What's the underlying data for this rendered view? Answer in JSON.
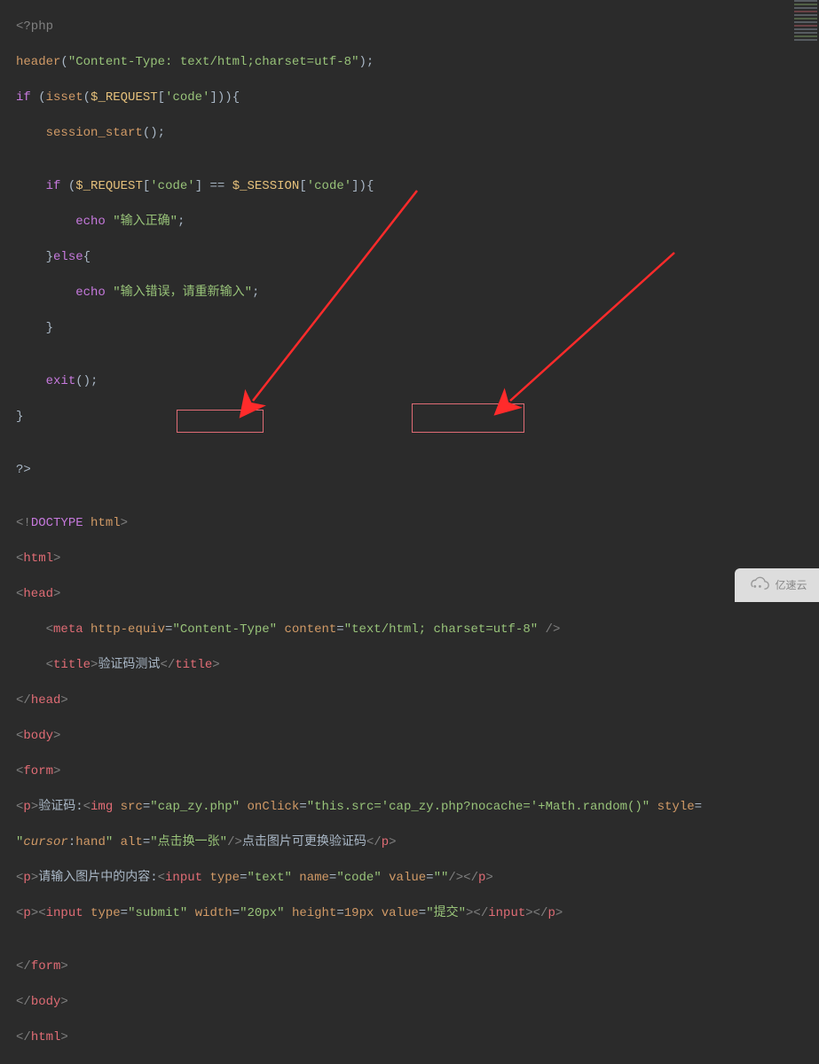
{
  "code": {
    "l1": "<?php",
    "l2a": "header",
    "l2b": "(",
    "l2c": "\"Content-Type: text/html;charset=utf-8\"",
    "l2d": ");",
    "l3a": "if",
    "l3b": " (",
    "l3c": "isset",
    "l3d": "(",
    "l3e": "$_REQUEST",
    "l3f": "[",
    "l3g": "'code'",
    "l3h": "])){",
    "l4a": "    ",
    "l4b": "session_start",
    "l4c": "();",
    "l5": "",
    "l6a": "    ",
    "l6b": "if",
    "l6c": " (",
    "l6d": "$_REQUEST",
    "l6e": "[",
    "l6f": "'code'",
    "l6g": "] == ",
    "l6h": "$_SESSION",
    "l6i": "[",
    "l6j": "'code'",
    "l6k": "]){",
    "l7a": "        ",
    "l7b": "echo",
    "l7c": " ",
    "l7d": "\"输入正确\"",
    "l7e": ";",
    "l8a": "    }",
    "l8b": "else",
    "l8c": "{",
    "l9a": "        ",
    "l9b": "echo",
    "l9c": " ",
    "l9d": "\"输入错误，请重新输入\"",
    "l9e": ";",
    "l10": "    }",
    "l11": "",
    "l12a": "    ",
    "l12b": "exit",
    "l12c": "();",
    "l13": "}",
    "l14": "",
    "l15": "?>",
    "l16": "",
    "l17a": "<!",
    "l17b": "DOCTYPE",
    "l17c": " ",
    "l17d": "html",
    "l17e": ">",
    "l18a": "<",
    "l18b": "html",
    "l18c": ">",
    "l19a": "<",
    "l19b": "head",
    "l19c": ">",
    "l20a": "    <",
    "l20b": "meta",
    "l20c": " ",
    "l20d": "http-equiv",
    "l20e": "=",
    "l20f": "\"Content-Type\"",
    "l20g": " ",
    "l20h": "content",
    "l20i": "=",
    "l20j": "\"text/html; charset=utf-8\"",
    "l20k": " />",
    "l21a": "    <",
    "l21b": "title",
    "l21c": ">",
    "l21d": "验证码测试",
    "l21e": "</",
    "l21f": "title",
    "l21g": ">",
    "l22a": "</",
    "l22b": "head",
    "l22c": ">",
    "l23a": "<",
    "l23b": "body",
    "l23c": ">",
    "l24a": "<",
    "l24b": "form",
    "l24c": ">",
    "l25a": "<",
    "l25b": "p",
    "l25c": ">",
    "l25d": "验证码:",
    "l25e": "<",
    "l25f": "img",
    "l25g": " ",
    "l25h": "src",
    "l25i": "=",
    "l25j": "\"",
    "l25k": "cap_zy.php",
    "l25l": "\"",
    "l25m": " ",
    "l25n": "onClick",
    "l25o": "=",
    "l25p": "\"this.src='",
    "l25q": "cap_zy.php",
    "l25r": "?nocache='+Math.random()\"",
    "l25s": " ",
    "l25t": "style",
    "l25u": "=",
    "l26a": "\"",
    "l26b": "cursor",
    "l26c": ":",
    "l26d": "hand",
    "l26e": "\"",
    "l26f": " ",
    "l26g": "alt",
    "l26h": "=",
    "l26i": "\"点击换一张\"",
    "l26j": "/>",
    "l26k": "点击图片可更换验证码",
    "l26l": "</",
    "l26m": "p",
    "l26n": ">",
    "l27a": "<",
    "l27b": "p",
    "l27c": ">",
    "l27d": "请输入图片中的内容:",
    "l27e": "<",
    "l27f": "input",
    "l27g": " ",
    "l27h": "type",
    "l27i": "=",
    "l27j": "\"text\"",
    "l27k": " ",
    "l27l": "name",
    "l27m": "=",
    "l27n": "\"code\"",
    "l27o": " ",
    "l27p": "value",
    "l27q": "=",
    "l27r": "\"\"",
    "l27s": "/></",
    "l27t": "p",
    "l27u": ">",
    "l28a": "<",
    "l28b": "p",
    "l28c": ">",
    "l28d": "<",
    "l28e": "input",
    "l28f": " ",
    "l28g": "type",
    "l28h": "=",
    "l28i": "\"submit\"",
    "l28j": " ",
    "l28k": "width",
    "l28l": "=",
    "l28m": "\"20px\"",
    "l28n": " ",
    "l28o": "height",
    "l28p": "=",
    "l28q": "19px",
    "l28r": " ",
    "l28s": "value",
    "l28t": "=",
    "l28u": "\"提交\"",
    "l28v": "></",
    "l28w": "input",
    "l28x": ">",
    "l28y": "</",
    "l28z": "p",
    "l28aa": ">",
    "l29": "",
    "l30a": "</",
    "l30b": "form",
    "l30c": ">",
    "l31a": "</",
    "l31b": "body",
    "l31c": ">",
    "l32a": "</",
    "l32b": "html",
    "l32c": ">"
  },
  "watermark_text": "亿速云"
}
